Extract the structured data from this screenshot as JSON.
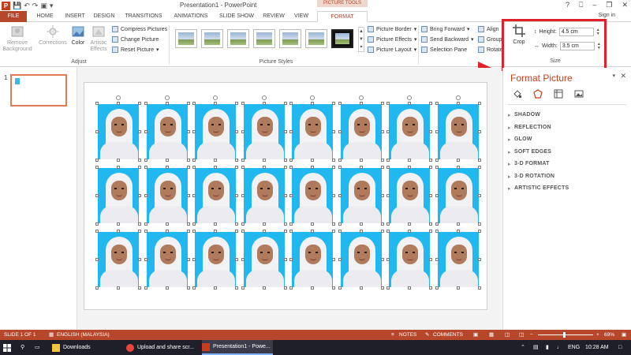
{
  "window": {
    "title": "Presentation1 - PowerPoint",
    "tools_label": "PICTURE TOOLS",
    "controls": [
      "?",
      "⎕",
      "–",
      "❐",
      "✕"
    ]
  },
  "tabs": [
    "FILE",
    "HOME",
    "INSERT",
    "DESIGN",
    "TRANSITIONS",
    "ANIMATIONS",
    "SLIDE SHOW",
    "REVIEW",
    "VIEW",
    "FORMAT"
  ],
  "signin": "Sign in",
  "ribbon": {
    "adjust": {
      "remove_background": "Remove\nBackground",
      "corrections": "Corrections",
      "color": "Color",
      "artistic_effects": "Artistic\nEffects",
      "compress": "Compress Pictures",
      "change": "Change Picture",
      "reset": "Reset Picture",
      "label": "Adjust"
    },
    "styles": {
      "label": "Picture Styles",
      "count": 7
    },
    "picture_buttons": [
      "Picture Border",
      "Picture Effects",
      "Picture Layout"
    ],
    "arrange": [
      "Bring Forward",
      "Send Backward",
      "Selection Pane",
      "Align",
      "Group",
      "Rotate"
    ],
    "size": {
      "crop": "Crop",
      "height_label": "Height:",
      "height_value": "4.5 cm",
      "width_label": "Width:",
      "width_value": "3.5 cm",
      "label": "Size"
    }
  },
  "slide_panel": {
    "slide_number": "1"
  },
  "format_pane": {
    "title": "Format Picture",
    "sections": [
      "SHADOW",
      "REFLECTION",
      "GLOW",
      "SOFT EDGES",
      "3-D FORMAT",
      "3-D ROTATION",
      "ARTISTIC EFFECTS"
    ]
  },
  "photos": {
    "rows": 3,
    "cols": 8
  },
  "status": {
    "slide": "SLIDE 1 OF 1",
    "language": "ENGLISH (MALAYSIA)",
    "notes": "NOTES",
    "comments": "COMMENTS",
    "zoom": "69%"
  },
  "taskbar": {
    "items": [
      "Downloads",
      "Upload and share scr...",
      "Presentation1 - Powe..."
    ],
    "lang": "ENG",
    "time": "10:28 AM"
  },
  "colors": {
    "accent": "#b7472a",
    "photo_bg": "#21b7ef",
    "highlight": "#e0202a"
  }
}
